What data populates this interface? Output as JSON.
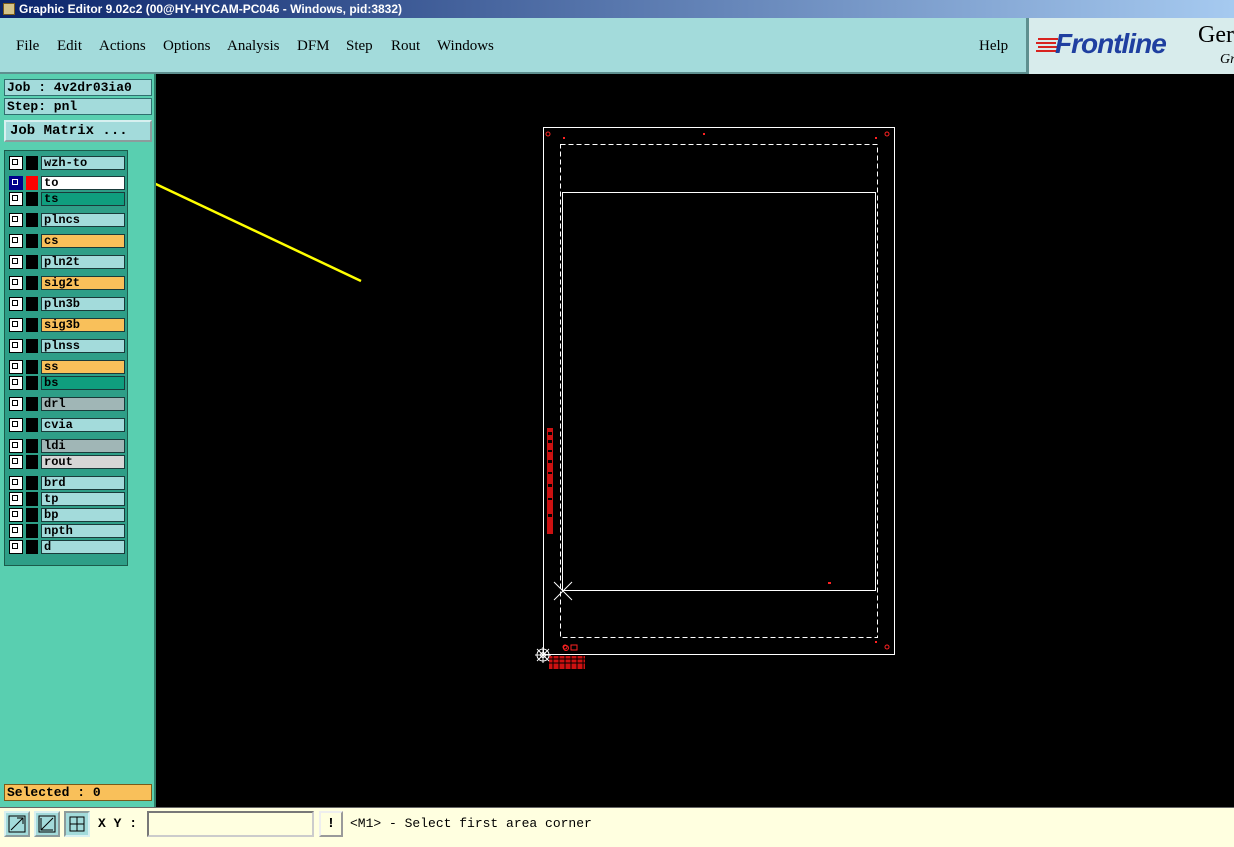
{
  "window": {
    "title": "Graphic Editor 9.02c2 (00@HY-HYCAM-PC046 - Windows, pid:3832)"
  },
  "menu": {
    "items": [
      "File",
      "Edit",
      "Actions",
      "Options",
      "Analysis",
      "DFM",
      "Step",
      "Rout",
      "Windows"
    ],
    "help": "Help"
  },
  "logo": {
    "brand": "Frontline",
    "product_fragment": "Ger",
    "sub_fragment": "Gr"
  },
  "job_info": {
    "job": "Job : 4v2dr03ia0",
    "step": "Step: pnl",
    "matrix_button": "Job Matrix ..."
  },
  "layers": [
    {
      "name": "wzh-to",
      "color": "#a3dbdb",
      "checked": false,
      "swatch": "#000000"
    },
    {
      "name": "to",
      "color": "#ffffff",
      "checked": true,
      "swatch": "#ff0000"
    },
    {
      "name": "ts",
      "color": "#0f9e7e",
      "checked": false,
      "swatch": "#000000"
    },
    {
      "name": "plncs",
      "color": "#a3dbdb",
      "checked": false,
      "swatch": "#000000"
    },
    {
      "name": "cs",
      "color": "#f9c05a",
      "checked": false,
      "swatch": "#000000"
    },
    {
      "name": "pln2t",
      "color": "#a3dbdb",
      "checked": false,
      "swatch": "#000000"
    },
    {
      "name": "sig2t",
      "color": "#f9c05a",
      "checked": false,
      "swatch": "#000000"
    },
    {
      "name": "pln3b",
      "color": "#a3dbdb",
      "checked": false,
      "swatch": "#000000"
    },
    {
      "name": "sig3b",
      "color": "#f9c05a",
      "checked": false,
      "swatch": "#000000"
    },
    {
      "name": "plnss",
      "color": "#a3dbdb",
      "checked": false,
      "swatch": "#000000"
    },
    {
      "name": "ss",
      "color": "#f9c05a",
      "checked": false,
      "swatch": "#000000"
    },
    {
      "name": "bs",
      "color": "#0f9e7e",
      "checked": false,
      "swatch": "#000000"
    },
    {
      "name": "drl",
      "color": "#a0b6b6",
      "checked": false,
      "swatch": "#000000"
    },
    {
      "name": "cvia",
      "color": "#a3dbdb",
      "checked": false,
      "swatch": "#000000"
    },
    {
      "name": "ldi",
      "color": "#a0b6b6",
      "checked": false,
      "swatch": "#000000"
    },
    {
      "name": "rout",
      "color": "#d6d6d6",
      "checked": false,
      "swatch": "#000000"
    },
    {
      "name": "brd",
      "color": "#a3dbdb",
      "checked": false,
      "swatch": "#000000"
    },
    {
      "name": "tp",
      "color": "#a3dbdb",
      "checked": false,
      "swatch": "#000000"
    },
    {
      "name": "bp",
      "color": "#a3dbdb",
      "checked": false,
      "swatch": "#000000"
    },
    {
      "name": "npth",
      "color": "#a3dbdb",
      "checked": false,
      "swatch": "#000000"
    },
    {
      "name": "d",
      "color": "#a3dbdb",
      "checked": false,
      "swatch": "#000000"
    }
  ],
  "selected": "Selected : 0",
  "status": {
    "xy_label": "X Y :",
    "xy_value": "",
    "excl": "!",
    "message": "<M1> - Select first area corner"
  },
  "colors": {
    "menu_bg": "#a3dbdb",
    "panel_bg": "#59cfb0",
    "annotation_arrow": "#ffff00",
    "board_outline": "#ffffff",
    "board_marks": "#ff0000"
  }
}
